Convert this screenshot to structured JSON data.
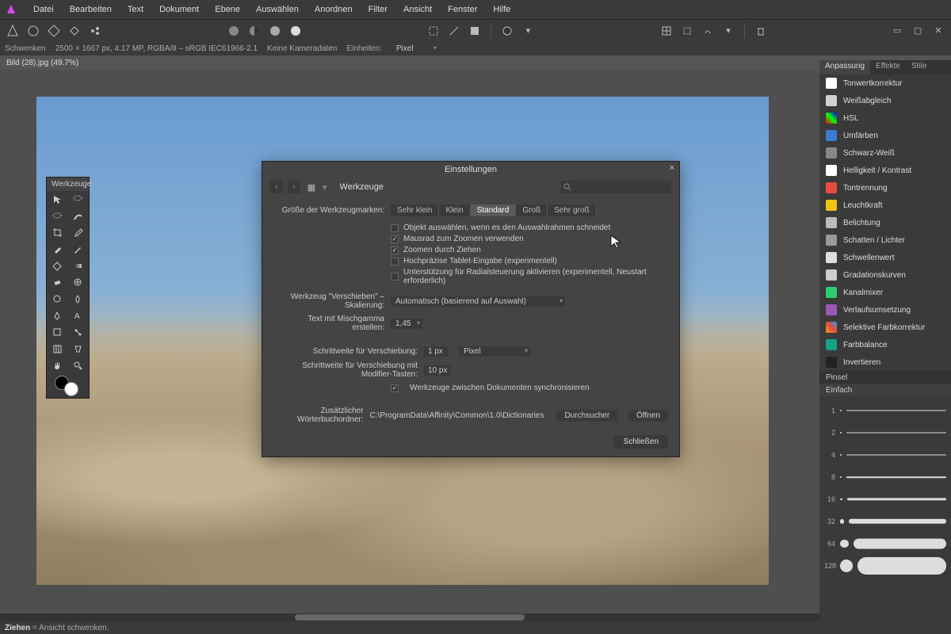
{
  "menu": [
    "Datei",
    "Bearbeiten",
    "Text",
    "Dokument",
    "Ebene",
    "Auswählen",
    "Anordnen",
    "Filter",
    "Ansicht",
    "Fenster",
    "Hilfe"
  ],
  "info": {
    "tool": "Schwenken",
    "dims": "2500 × 1667 px, 4.17 MP, RGBA/8 – sRGB IEC61966-2.1",
    "camera": "Keine Kameradaten",
    "units_label": "Einheiten:",
    "units_value": "Pixel"
  },
  "tab": {
    "title": "Bild (28).jpg (49.7%)"
  },
  "toolspanel": {
    "title": "Werkzeuge"
  },
  "right": {
    "tabs": [
      "Anpassung",
      "Effekte",
      "Stile"
    ],
    "adjustments": [
      {
        "label": "Tonwertkorrektur",
        "color": "#fff"
      },
      {
        "label": "Weißabgleich",
        "color": "#d0d0d0"
      },
      {
        "label": "HSL",
        "color": "linear-gradient(45deg,#f00,#0f0,#00f)"
      },
      {
        "label": "Umfärben",
        "color": "#3a7bd5"
      },
      {
        "label": "Schwarz-Weiß",
        "color": "#888"
      },
      {
        "label": "Helligkeit / Kontrast",
        "color": "#fff"
      },
      {
        "label": "Tontrennung",
        "color": "#e74c3c"
      },
      {
        "label": "Leuchtkraft",
        "color": "#f1c40f"
      },
      {
        "label": "Belichtung",
        "color": "#bbb"
      },
      {
        "label": "Schatten / Lichter",
        "color": "#999"
      },
      {
        "label": "Schwellenwert",
        "color": "#ddd"
      },
      {
        "label": "Gradationskurven",
        "color": "#ccc"
      },
      {
        "label": "Kanalmixer",
        "color": "#2ecc71"
      },
      {
        "label": "Verlaufsumsetzung",
        "color": "#9b59b6"
      },
      {
        "label": "Selektive Farbkorrektur",
        "color": "linear-gradient(45deg,#f39c12,#e74c3c,#3498db)"
      },
      {
        "label": "Farbbalance",
        "color": "#16a085"
      },
      {
        "label": "Invertieren",
        "color": "#222"
      }
    ],
    "brush_tab": "Pinsel",
    "brush_cat": "Einfach",
    "brushes": [
      1,
      2,
      4,
      8,
      16,
      32,
      64,
      128
    ]
  },
  "dialog": {
    "title": "Einstellungen",
    "crumb": "Werkzeuge",
    "size_label": "Größe der Werkzeugmarken:",
    "sizes": [
      "Sehr klein",
      "Klein",
      "Standard",
      "Groß",
      "Sehr groß"
    ],
    "size_active": 2,
    "checks": [
      {
        "label": "Objekt auswählen, wenn es den Auswahlrahmen schneidet",
        "on": false
      },
      {
        "label": "Mausrad zum Zoomen verwenden",
        "on": true
      },
      {
        "label": "Zoomen durch Ziehen",
        "on": true
      },
      {
        "label": "Hochpräzise Tablet-Eingabe (experimentell)",
        "on": false
      },
      {
        "label": "Unterstützung für Radialsteuerung aktivieren (experimentell, Neustart erforderlich)",
        "on": false
      }
    ],
    "scale_label": "Werkzeug \"Verschieben\" – Skalierung:",
    "scale_value": "Automatisch (basierend auf Auswahl)",
    "gamma_label": "Text mit Mischgamma erstellen:",
    "gamma_value": "1,45",
    "nudge_label": "Schrittweite für Verschiebung:",
    "nudge_value": "1 px",
    "nudge2_label": "Schrittweite für Verschiebung mit Modifier-Tasten:",
    "nudge2_value": "10 px",
    "nudge_unit": "Pixel",
    "sync_label": "Werkzeuge zwischen Dokumenten synchronisieren",
    "sync_on": true,
    "dict_label": "Zusätzlicher Wörterbuchordner:",
    "dict_value": "C:\\ProgramData\\Affinity\\Common\\1.0\\Dictionaries",
    "btn_browse": "Durchsucher",
    "btn_open": "Öffnen",
    "btn_close": "Schließen"
  },
  "status": {
    "hint": "Ziehen = Ansicht schwenken."
  }
}
